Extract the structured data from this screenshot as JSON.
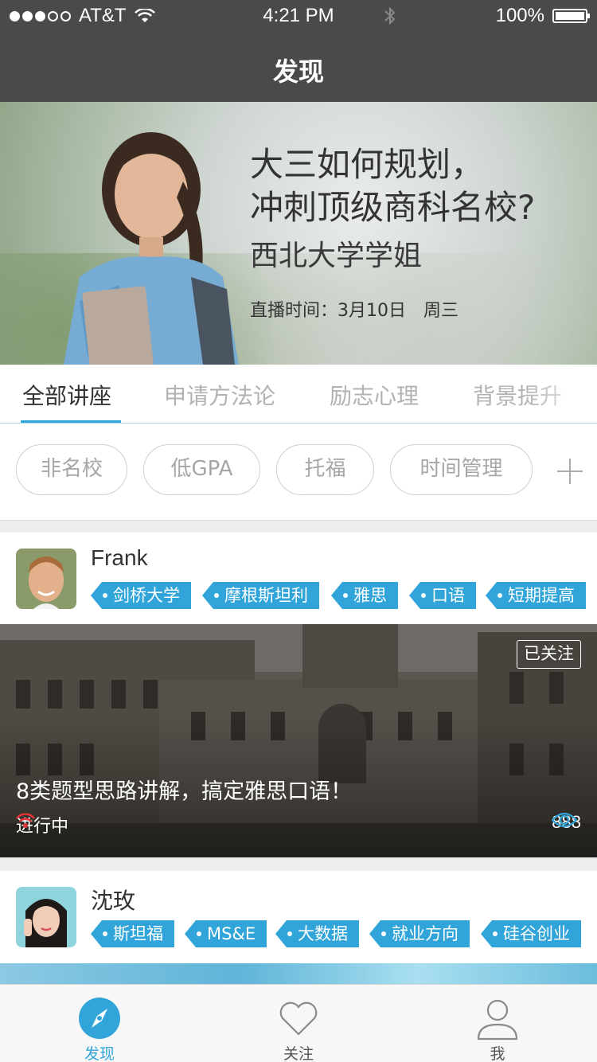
{
  "status_bar": {
    "carrier": "AT&T",
    "time": "4:21 PM",
    "battery": "100%"
  },
  "nav": {
    "title": "发现"
  },
  "banner": {
    "line1": "大三如何规划，",
    "line2": "冲刺顶级商科名校?",
    "subtitle": "西北大学学姐",
    "schedule": "直播时间：3月10日　周三"
  },
  "category_tabs": [
    "全部讲座",
    "申请方法论",
    "励志心理",
    "背景提升"
  ],
  "filters": [
    "非名校",
    "低GPA",
    "托福",
    "时间管理"
  ],
  "cards": [
    {
      "name": "Frank",
      "tags": [
        "剑桥大学",
        "摩根斯坦利",
        "雅思",
        "口语",
        "短期提高"
      ],
      "follow_label": "已关注",
      "title": "8类题型思路讲解，搞定雅思口语！",
      "status": "进行中",
      "views": "888"
    },
    {
      "name": "沈玫",
      "tags": [
        "斯坦福",
        "MS&E",
        "大数据",
        "就业方向",
        "硅谷创业"
      ]
    }
  ],
  "tab_bar": [
    "发现",
    "关注",
    "我"
  ],
  "colors": {
    "accent": "#31a5d9",
    "nav_bg": "#4a4a4a",
    "live_red": "#e0333a"
  }
}
